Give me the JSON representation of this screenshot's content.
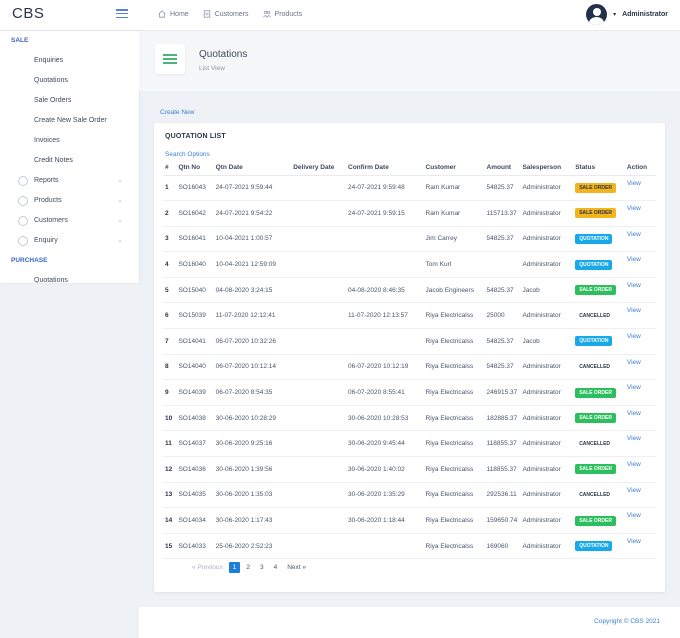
{
  "app": {
    "brand": "CBS"
  },
  "topnav": [
    {
      "label": "Home",
      "icon": "home-icon"
    },
    {
      "label": "Customers",
      "icon": "customers-icon"
    },
    {
      "label": "Products",
      "icon": "products-icon"
    }
  ],
  "user": {
    "name": "Administrator"
  },
  "sidebar": {
    "sale_heading": "SALE",
    "sale_items": [
      "Enquiries",
      "Quotations",
      "Sale Orders",
      "Create New Sale Order",
      "Invoices",
      "Credit Notes"
    ],
    "group_items": [
      "Reports",
      "Products",
      "Customers",
      "Enquiry"
    ],
    "purchase_heading": "PURCHASE",
    "purchase_items": [
      "Quotations"
    ]
  },
  "page": {
    "title": "Quotations",
    "subtitle": "List View",
    "create_new": "Create New"
  },
  "card": {
    "title": "QUOTATION LIST",
    "search_options": "Search Options"
  },
  "table": {
    "headers": [
      "#",
      "Qtn No",
      "Qtn Date",
      "Delivery Date",
      "Confirm Date",
      "Customer",
      "Amount",
      "Salesperson",
      "Status",
      "Action"
    ],
    "rows": [
      [
        "1",
        "SO16043",
        "24-07-2021 9:59:44",
        "",
        "24-07-2021 9:59:48",
        "Ram Kumar",
        "54825.37",
        "Administrator",
        "SALE ORDER",
        "View"
      ],
      [
        "2",
        "SO16042",
        "24-07-2021 9:54:22",
        "",
        "24-07-2021 9:59:15",
        "Ram Kumar",
        "115713.37",
        "Administrator",
        "SALE ORDER",
        "View"
      ],
      [
        "3",
        "SO16041",
        "10-04-2021 1:00:57",
        "",
        "",
        "Jim Carrey",
        "54825.37",
        "Administrator",
        "QUOTATION",
        "View"
      ],
      [
        "4",
        "SO16040",
        "10-04-2021 12:59:09",
        "",
        "",
        "Tom Kurl",
        "",
        "Administrator",
        "QUOTATION",
        "View"
      ],
      [
        "5",
        "SO15040",
        "04-08-2020 3:24:15",
        "",
        "04-08-2020 8:46:35",
        "Jacob Engineers",
        "54825.37",
        "Jacob",
        "SALE ORDER",
        "View"
      ],
      [
        "6",
        "SO15039",
        "11-07-2020 12:12:41",
        "",
        "11-07-2020 12:13:57",
        "Riya Electricalss",
        "25000",
        "Administrator",
        "CANCELLED",
        "View"
      ],
      [
        "7",
        "SO14041",
        "06-07-2020 10:32:26",
        "",
        "",
        "Riya Electricalss",
        "54825.37",
        "Jacob",
        "QUOTATION",
        "View"
      ],
      [
        "8",
        "SO14040",
        "06-07-2020 10:12:14",
        "",
        "06-07-2020 10:12:19",
        "Riya Electricalss",
        "54825.37",
        "Administrator",
        "CANCELLED",
        "View"
      ],
      [
        "9",
        "SO14039",
        "06-07-2020 8:54:35",
        "",
        "06-07-2020 8:55:41",
        "Riya Electricalss",
        "246915.37",
        "Administrator",
        "SALE ORDER",
        "View"
      ],
      [
        "10",
        "SO14038",
        "30-06-2020 10:28:29",
        "",
        "30-06-2020 10:28:53",
        "Riya Electricalss",
        "182885.37",
        "Administrator",
        "SALE ORDER",
        "View"
      ],
      [
        "11",
        "SO14037",
        "30-06-2020 9:25:16",
        "",
        "30-06-2020 9:45:44",
        "Riya Electricalss",
        "118855.37",
        "Administrator",
        "CANCELLED",
        "View"
      ],
      [
        "12",
        "SO14036",
        "30-06-2020 1:39:56",
        "",
        "30-06-2020 1:40:02",
        "Riya Electricalss",
        "118855.37",
        "Administrator",
        "SALE ORDER",
        "View"
      ],
      [
        "13",
        "SO14035",
        "30-06-2020 1:35:03",
        "",
        "30-06-2020 1:35:29",
        "Riya Electricalss",
        "292536.11",
        "Administrator",
        "CANCELLED",
        "View"
      ],
      [
        "14",
        "SO14034",
        "30-06-2020 1:17:43",
        "",
        "30-06-2020 1:18:44",
        "Riya Electricalss",
        "159650.74",
        "Administrator",
        "SALE ORDER",
        "View"
      ],
      [
        "15",
        "SO14033",
        "25-06-2020 2:52:23",
        "",
        "",
        "Riya Electricalss",
        "169060",
        "Administrator",
        "QUOTATION",
        "View"
      ]
    ]
  },
  "pagination": {
    "prev": "« Previous",
    "pages": [
      "1",
      "2",
      "3",
      "4"
    ],
    "current": "1",
    "next": "Next »"
  },
  "footer": {
    "copyright": "Copyright © CBS 2021"
  },
  "colors": {
    "accent": "#1e7fd8",
    "sale_order_badge": "#f3b51e",
    "quotation_badge": "#17a9e8",
    "so_badge": "#2bbf5e"
  }
}
